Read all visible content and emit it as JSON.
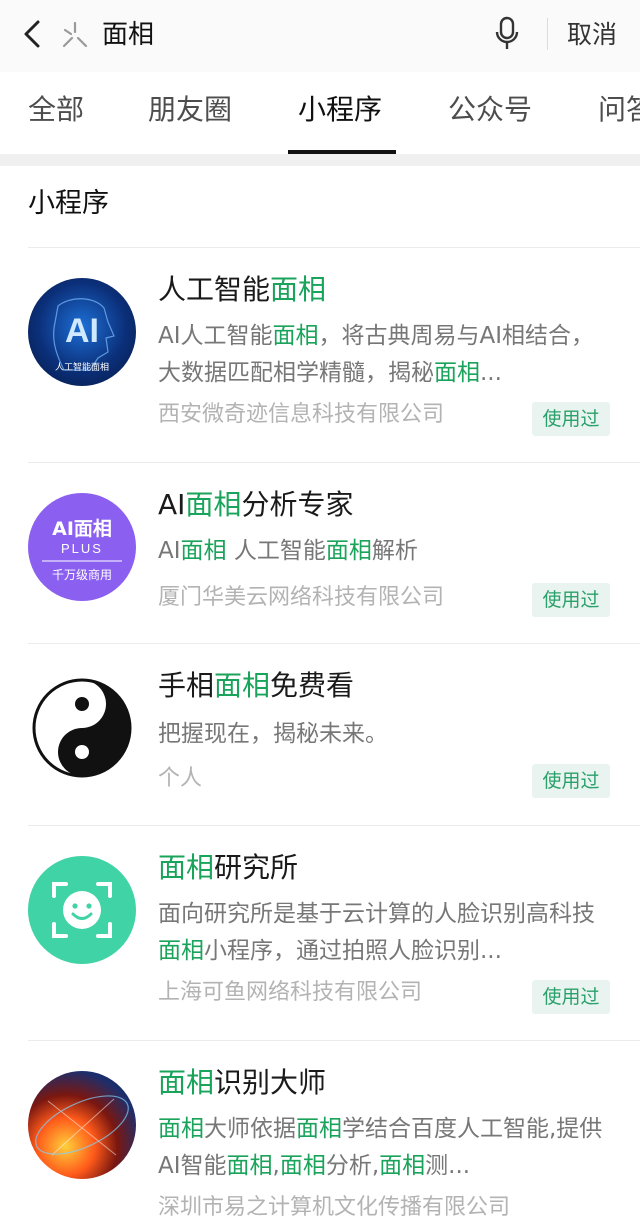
{
  "search": {
    "query": "面相",
    "cancel_label": "取消"
  },
  "tabs": [
    {
      "label": "全部",
      "active": false
    },
    {
      "label": "朋友圈",
      "active": false
    },
    {
      "label": "小程序",
      "active": true
    },
    {
      "label": "公众号",
      "active": false
    },
    {
      "label": "问答",
      "active": false
    }
  ],
  "section_title": "小程序",
  "highlight_color": "#1aa35a",
  "used_badge": "使用过",
  "results": [
    {
      "title": [
        "人工智能",
        {
          "h": "面相"
        }
      ],
      "desc": [
        "AI人工智能",
        {
          "h": "面相"
        },
        "，将古典周易与AI相结合，大数据匹配相学精髓，揭秘",
        {
          "h": "面相"
        },
        "..."
      ],
      "org": "西安微奇迹信息科技有限公司",
      "badge": "使用过",
      "avatar": {
        "icon": "ai-face-icon",
        "text": "AI",
        "caption": "人工智能面相"
      }
    },
    {
      "title": [
        "AI",
        {
          "h": "面相"
        },
        "分析专家"
      ],
      "desc": [
        "AI",
        {
          "h": "面相"
        },
        " 人工智能",
        {
          "h": "面相"
        },
        "解析"
      ],
      "org": "厦门华美云网络科技有限公司",
      "badge": "使用过",
      "avatar": {
        "icon": "ai-plus-icon",
        "line1": "AI面相",
        "line2": "PLUS",
        "line3": "千万级商用"
      }
    },
    {
      "title": [
        "手相",
        {
          "h": "面相"
        },
        "免费看"
      ],
      "desc": [
        "把握现在，揭秘未来。"
      ],
      "org": "个人",
      "badge": "使用过",
      "avatar": {
        "icon": "yin-yang-icon"
      }
    },
    {
      "title": [
        {
          "h": "面相"
        },
        "研究所"
      ],
      "desc": [
        "面向研究所是基于云计算的人脸识别高科技",
        {
          "h": "面相"
        },
        "小程序，通过拍照人脸识别..."
      ],
      "org": "上海可鱼网络科技有限公司",
      "badge": "使用过",
      "avatar": {
        "icon": "smiley-scan-icon"
      }
    },
    {
      "title": [
        {
          "h": "面相"
        },
        "识别大师"
      ],
      "desc": [
        {
          "h": "面相"
        },
        "大师依据",
        {
          "h": "面相"
        },
        "学结合百度人工智能,提供AI智能",
        {
          "h": "面相"
        },
        ",",
        {
          "h": "面相"
        },
        "分析,",
        {
          "h": "面相"
        },
        "测..."
      ],
      "org": "深圳市易之计算机文化传播有限公司",
      "badge": null,
      "avatar": {
        "icon": "fire-globe-icon"
      }
    }
  ]
}
